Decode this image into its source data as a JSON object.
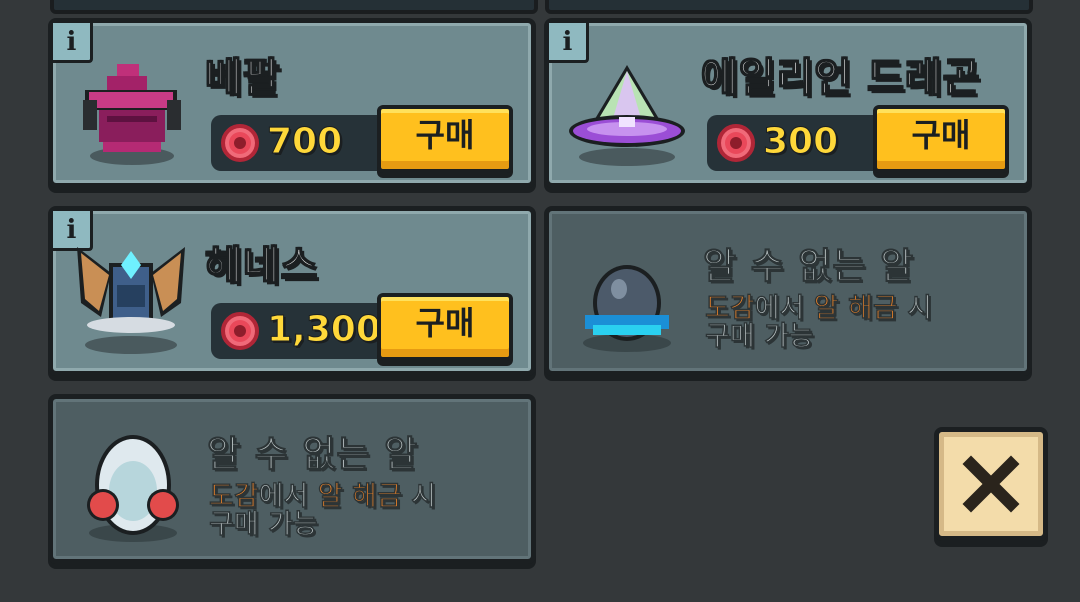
{
  "pets": [
    {
      "name": "베팔",
      "price": "700",
      "buy_label": "구매",
      "info_label": "i",
      "icon": "purple-helmet-icon"
    },
    {
      "name": "에일리언 드래곤",
      "price": "300",
      "buy_label": "구매",
      "info_label": "i",
      "icon": "pyramid-ufo-icon"
    },
    {
      "name": "헤네스",
      "price": "1,300",
      "buy_label": "구매",
      "info_label": "i",
      "icon": "winged-crest-icon"
    }
  ],
  "locked": [
    {
      "title": "알 수 없는 알",
      "hint_part1": "도감",
      "hint_part2": "에서 ",
      "hint_part3": "알 해금",
      "hint_part4": " 시",
      "hint_line2": "구매 가능",
      "icon": "dark-egg-icon"
    },
    {
      "title": "알 수 없는 알",
      "hint_part1": "도감",
      "hint_part2": "에서 ",
      "hint_part3": "알 해금",
      "hint_part4": " 시",
      "hint_line2": "구매 가능",
      "icon": "white-egg-icon"
    }
  ],
  "close_icon": "close-x-icon",
  "colors": {
    "accent_yellow": "#ffc01e",
    "highlight_orange": "#ff8a27",
    "price_yellow": "#ffd83a",
    "coin_red": "#e9485a"
  }
}
